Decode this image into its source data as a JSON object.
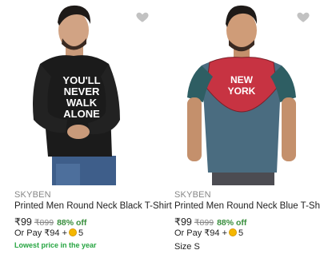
{
  "products": [
    {
      "brand": "SKYBEN",
      "title": "Printed Men Round Neck Black T-Shirt",
      "price": "₹99",
      "mrp": "₹899",
      "discount": "88% off",
      "pay_prefix": "Or Pay ₹94 +",
      "coins": "5",
      "extra": "Lowest price in the year",
      "shirt_print": [
        "YOU'LL",
        "NEVER",
        "WALK",
        "ALONE"
      ],
      "shirt_color": "#1b1b1b"
    },
    {
      "brand": "SKYBEN",
      "title": "Printed Men Round Neck Blue T-Shirt",
      "price": "₹99",
      "mrp": "₹899",
      "discount": "88% off",
      "pay_prefix": "Or Pay ₹94 +",
      "coins": "5",
      "extra": "Size S",
      "shirt_print": [
        "NEW",
        "YORK"
      ],
      "shirt_color": "#4a6c80"
    }
  ],
  "colors": {
    "accent": "#2874f0",
    "discount": "#388e3c",
    "badge": "#26a541",
    "muted": "#878787"
  },
  "icons": [
    "heart-icon",
    "coin-icon"
  ]
}
